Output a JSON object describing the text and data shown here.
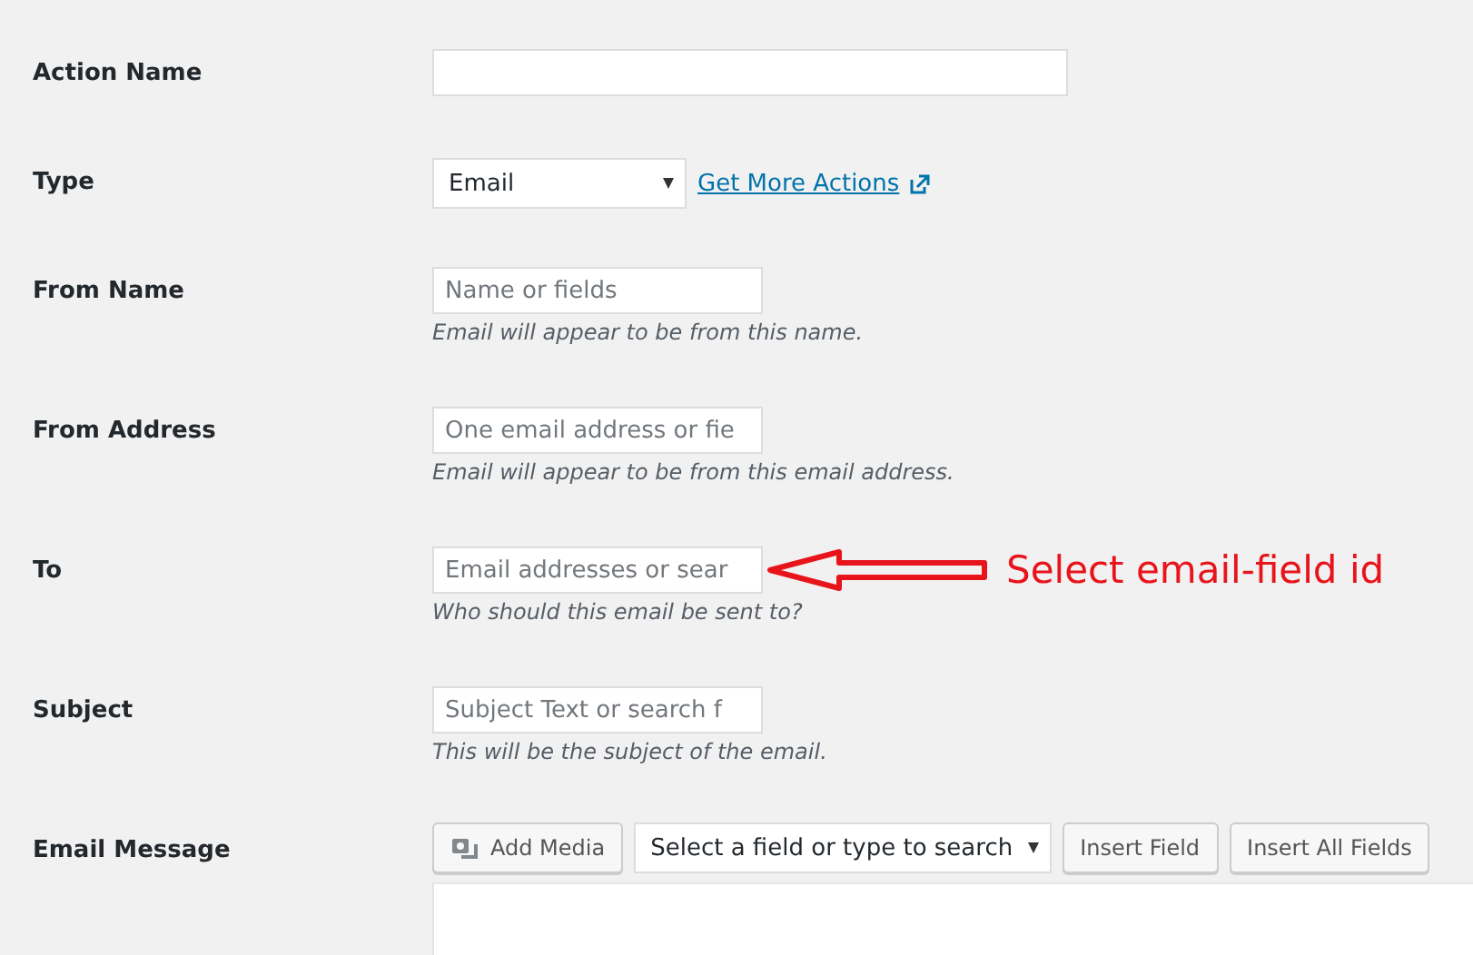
{
  "fields": [
    {
      "kind": "text",
      "label": "Action Name"
    },
    {
      "kind": "select",
      "label": "Type",
      "value": "Email",
      "link": "Get More Actions"
    },
    {
      "kind": "text",
      "label": "From Name",
      "placeholder": "Name or fields",
      "description": "Email will appear to be from this name."
    },
    {
      "kind": "text",
      "label": "From Address",
      "placeholder": "One email address or fie",
      "description": "Email will appear to be from this email address."
    },
    {
      "kind": "text",
      "label": "To",
      "placeholder": "Email addresses or sear",
      "description": "Who should this email be sent to?",
      "annotation": "Select email-field id"
    },
    {
      "kind": "text",
      "label": "Subject",
      "placeholder": "Subject Text or search f",
      "description": "This will be the subject of the email."
    },
    {
      "kind": "editor",
      "label": "Email Message",
      "media_button": "Add Media",
      "field_select": "Select a field or type to search",
      "buttons": [
        "Insert Field",
        "Insert All Fields"
      ]
    }
  ]
}
